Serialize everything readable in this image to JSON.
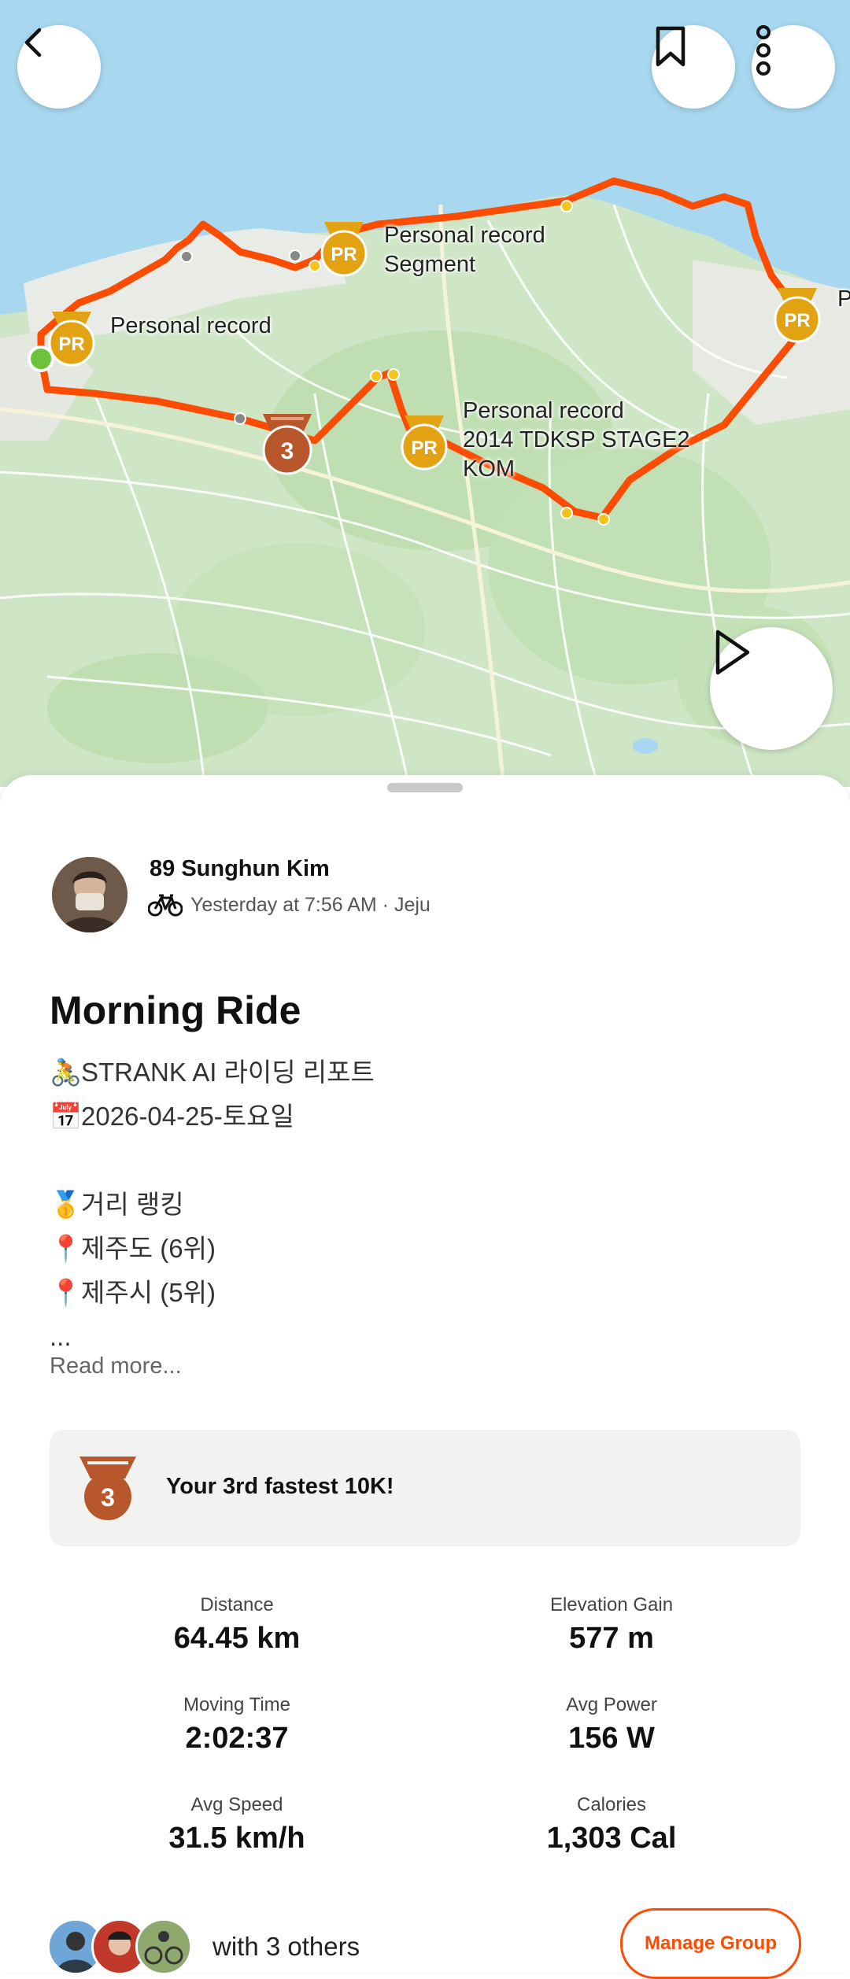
{
  "map": {
    "labels": {
      "pr_west": "Personal record",
      "pr_north": "Personal record\nSegment",
      "pr_east_cut": "P",
      "pr_south": "Personal record\n2014 TDKSP STAGE2\nKOM"
    },
    "badges": {
      "pr": "PR",
      "third": "3"
    },
    "colors": {
      "route": "#fc4c02",
      "sea": "#a8d8f0",
      "land": "#cfe6c6",
      "pr_gold": "#e2a212",
      "bronze": "#b8562c"
    }
  },
  "icons": {
    "back": "chevron-left-icon",
    "bookmark": "bookmark-icon",
    "more": "more-vertical-icon",
    "play": "play-icon",
    "bike": "bike-icon",
    "medal": "bronze-medal-icon"
  },
  "activity": {
    "athlete_name": "89 Sunghun Kim",
    "meta": "Yesterday at 7:56 AM · Jeju",
    "title": "Morning Ride",
    "description": [
      {
        "emoji": "🚴",
        "text": "STRANK AI 라이딩 리포트"
      },
      {
        "emoji": "📅",
        "text": "2026-04-25-토요일"
      },
      {
        "emoji": "",
        "text": ""
      },
      {
        "emoji": "🥇",
        "text": "거리 랭킹"
      },
      {
        "emoji": "📍",
        "text": "제주도 (6위)"
      },
      {
        "emoji": "📍",
        "text": "제주시 (5위)"
      },
      {
        "emoji": "",
        "text": "..."
      }
    ],
    "read_more": "Read more..."
  },
  "achievement": {
    "text": "Your 3rd fastest 10K!",
    "medal_rank": "3"
  },
  "stats": [
    {
      "label": "Distance",
      "value": "64.45 km"
    },
    {
      "label": "Elevation Gain",
      "value": "577 m"
    },
    {
      "label": "Moving Time",
      "value": "2:02:37"
    },
    {
      "label": "Avg Power",
      "value": "156 W"
    },
    {
      "label": "Avg Speed",
      "value": "31.5 km/h"
    },
    {
      "label": "Calories",
      "value": "1,303 Cal"
    }
  ],
  "group": {
    "others_text": "with 3 others",
    "manage_label": "Manage Group"
  }
}
